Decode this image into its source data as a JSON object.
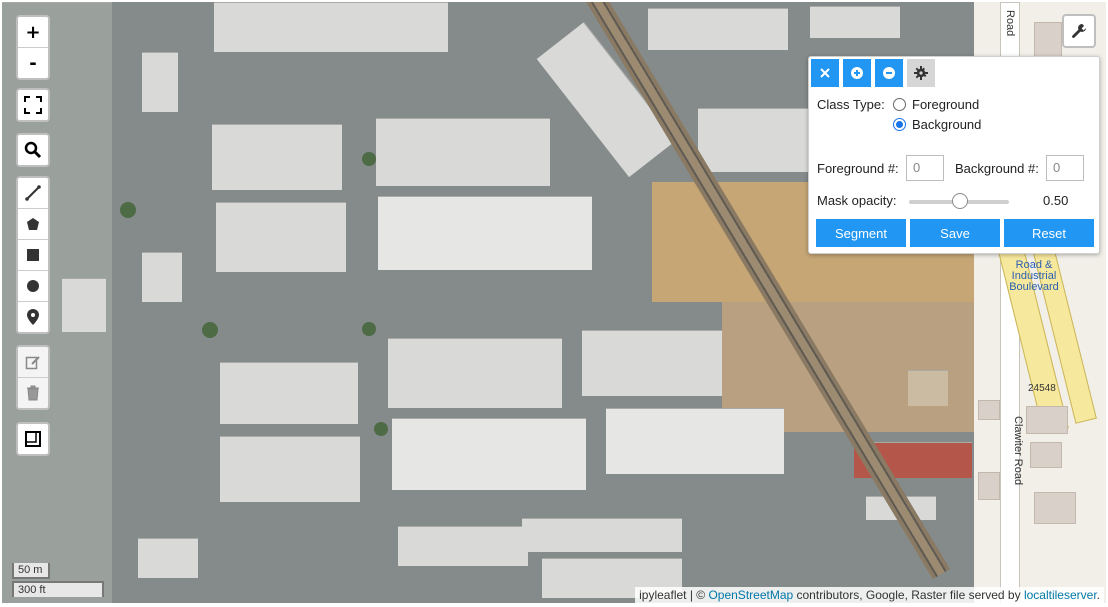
{
  "map": {
    "zoom_in_label": "+",
    "zoom_out_label": "-",
    "scale_metric": "50 m",
    "scale_imperial": "300 ft",
    "street_labels": {
      "road_top": "Road",
      "road_boulevard": "Road & Industrial Boulevard",
      "clawiter": "Clawiter Road",
      "address": "24548"
    },
    "attribution": {
      "prefix": "ipyleaflet | © ",
      "osm_link": "OpenStreetMap",
      "middle": " contributors, Google, Raster file served by ",
      "server_link": "localtileserver",
      "suffix": "."
    }
  },
  "toolbar_icons": {
    "close": "close-icon",
    "add": "plus-circle-icon",
    "remove": "minus-circle-icon",
    "settings": "gear-icon",
    "wrench": "wrench-icon"
  },
  "segment_panel": {
    "class_type_label": "Class Type:",
    "options": [
      "Foreground",
      "Background"
    ],
    "selected": "Background",
    "foreground_count_label": "Foreground #:",
    "foreground_count": "0",
    "background_count_label": "Background #:",
    "background_count": "0",
    "mask_opacity_label": "Mask opacity:",
    "mask_opacity": 0.5,
    "mask_opacity_text": "0.50",
    "buttons": {
      "segment": "Segment",
      "save": "Save",
      "reset": "Reset"
    },
    "accent_color": "#2196f3"
  }
}
